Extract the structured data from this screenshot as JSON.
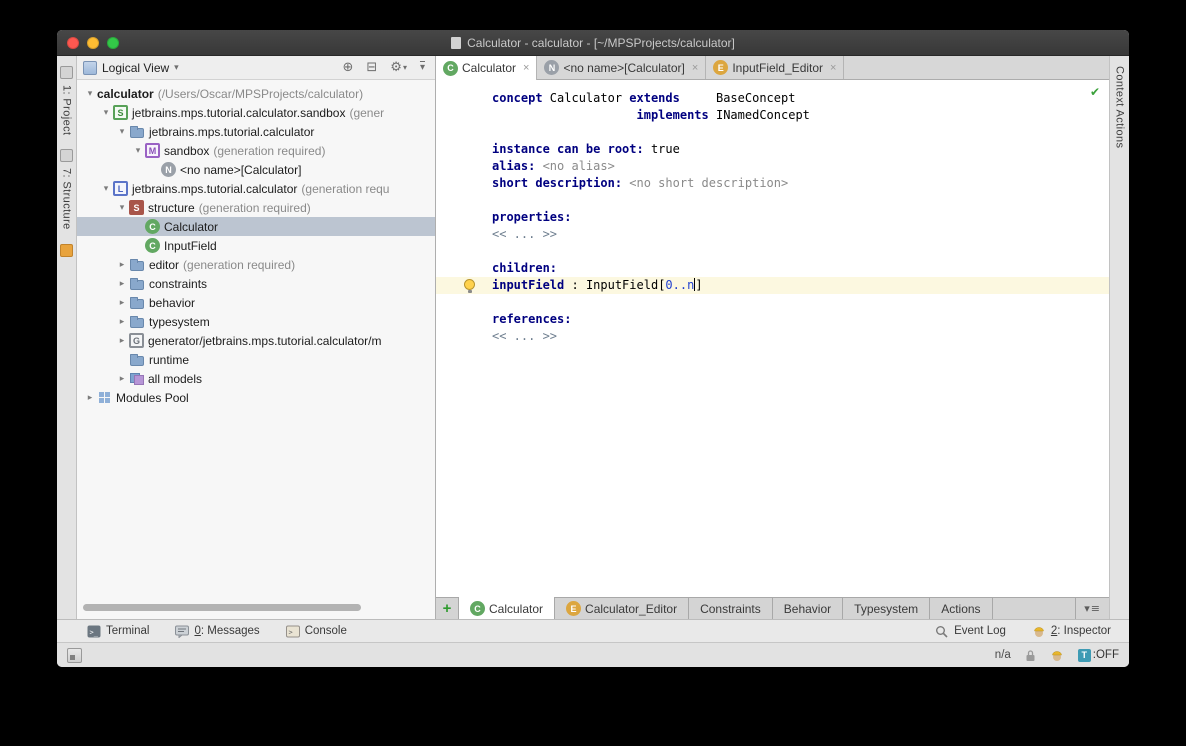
{
  "titlebar": {
    "title": "Calculator - calculator - [~/MPSProjects/calculator]"
  },
  "left_stripe": {
    "project_tab": "1: Project",
    "structure_tab": "7: Structure"
  },
  "right_stripe": {
    "context_actions_tab": "Context Actions"
  },
  "project_panel": {
    "view_selector": "Logical View",
    "header_icons": {
      "chevron": "▾",
      "locate": "⊕",
      "collapse": "⊟",
      "settings": "⚙",
      "settings_arrow": "▾",
      "hide": "▾"
    },
    "tree": [
      {
        "indent": 0,
        "arrow": "open",
        "icon": null,
        "label": "calculator",
        "suffix": "(/Users/Oscar/MPSProjects/calculator)",
        "bold": true
      },
      {
        "indent": 1,
        "arrow": "open",
        "icon": "solution",
        "label": "jetbrains.mps.tutorial.calculator.sandbox",
        "suffix": "(gener"
      },
      {
        "indent": 2,
        "arrow": "open",
        "icon": "folder",
        "label": "jetbrains.mps.tutorial.calculator"
      },
      {
        "indent": 3,
        "arrow": "open",
        "icon": "model",
        "label": "sandbox",
        "suffix": "(generation required)"
      },
      {
        "indent": 4,
        "arrow": null,
        "icon": "node",
        "label": "<no name>[Calculator]"
      },
      {
        "indent": 1,
        "arrow": "open",
        "icon": "language",
        "label": "jetbrains.mps.tutorial.calculator",
        "suffix": "(generation requ"
      },
      {
        "indent": 2,
        "arrow": "open",
        "icon": "structure",
        "label": "structure",
        "suffix": "(generation required)"
      },
      {
        "indent": 3,
        "arrow": null,
        "icon": "concept",
        "label": "Calculator",
        "selected": true
      },
      {
        "indent": 3,
        "arrow": null,
        "icon": "concept",
        "label": "InputField"
      },
      {
        "indent": 2,
        "arrow": "closed",
        "icon": "folder",
        "label": "editor",
        "suffix": "(generation required)"
      },
      {
        "indent": 2,
        "arrow": "closed",
        "icon": "folder",
        "label": "constraints"
      },
      {
        "indent": 2,
        "arrow": "closed",
        "icon": "folder",
        "label": "behavior"
      },
      {
        "indent": 2,
        "arrow": "closed",
        "icon": "folder",
        "label": "typesystem"
      },
      {
        "indent": 2,
        "arrow": "closed",
        "icon": "generator",
        "label": "generator/jetbrains.mps.tutorial.calculator/m"
      },
      {
        "indent": 2,
        "arrow": null,
        "icon": "folder",
        "label": "runtime"
      },
      {
        "indent": 2,
        "arrow": "closed",
        "icon": "models",
        "label": "all models"
      },
      {
        "indent": 0,
        "arrow": "closed",
        "icon": "modulesPool",
        "label": "Modules Pool"
      }
    ]
  },
  "icon_letters": {
    "concept": "C",
    "node": "N",
    "editor": "E",
    "solution": "S",
    "language": "L",
    "model": "M",
    "generator": "G",
    "structure": "S"
  },
  "editor_tabs": [
    {
      "icon": "concept",
      "label": "Calculator",
      "active": true
    },
    {
      "icon": "node",
      "label": "<no name>[Calculator]",
      "active": false
    },
    {
      "icon": "editor",
      "label": "InputField_Editor",
      "active": false
    }
  ],
  "editor": {
    "ok_check": "✔",
    "lines": [
      {
        "segments": [
          {
            "text": "concept ",
            "style": "kw"
          },
          {
            "text": "Calculator ",
            "style": "plain"
          },
          {
            "text": "extends",
            "style": "kw"
          },
          {
            "text": "     BaseConcept",
            "style": "plain"
          }
        ]
      },
      {
        "segments": [
          {
            "text": "                    ",
            "style": "plain"
          },
          {
            "text": "implements",
            "style": "kw"
          },
          {
            "text": " INamedConcept",
            "style": "plain"
          }
        ]
      },
      {
        "segments": []
      },
      {
        "segments": [
          {
            "text": "instance can be root:",
            "style": "kw"
          },
          {
            "text": " true",
            "style": "plain"
          }
        ]
      },
      {
        "segments": [
          {
            "text": "alias:",
            "style": "kw"
          },
          {
            "text": " <no alias>",
            "style": "muted"
          }
        ]
      },
      {
        "segments": [
          {
            "text": "short description:",
            "style": "kw"
          },
          {
            "text": " <no short description>",
            "style": "muted"
          }
        ]
      },
      {
        "segments": []
      },
      {
        "segments": [
          {
            "text": "properties:",
            "style": "kw"
          }
        ]
      },
      {
        "segments": [
          {
            "text": "<< ... >>",
            "style": "cellph"
          }
        ]
      },
      {
        "segments": []
      },
      {
        "segments": [
          {
            "text": "children:",
            "style": "kw"
          }
        ]
      },
      {
        "highlight": true,
        "bulb": true,
        "segments": [
          {
            "text": "inputField",
            "style": "kw"
          },
          {
            "text": " : ",
            "style": "plain"
          },
          {
            "text": "InputField",
            "style": "plain"
          },
          {
            "text": "[",
            "style": "plain"
          },
          {
            "text": "0..n",
            "style": "blue"
          },
          {
            "text": "",
            "style": "caret"
          },
          {
            "text": "]",
            "style": "plain"
          }
        ]
      },
      {
        "segments": []
      },
      {
        "segments": [
          {
            "text": "references:",
            "style": "kw"
          }
        ]
      },
      {
        "segments": [
          {
            "text": "<< ... >>",
            "style": "cellph"
          }
        ]
      }
    ]
  },
  "aspect_tabs": {
    "add_label": "+",
    "options_glyph": "▾≡",
    "tabs": [
      {
        "icon": "concept",
        "label": "Calculator",
        "active": true
      },
      {
        "icon": "editor",
        "label": "Calculator_Editor",
        "active": false
      },
      {
        "icon": null,
        "label": "Constraints",
        "active": false
      },
      {
        "icon": null,
        "label": "Behavior",
        "active": false
      },
      {
        "icon": null,
        "label": "Typesystem",
        "active": false
      },
      {
        "icon": null,
        "label": "Actions",
        "active": false
      }
    ]
  },
  "toolbar": {
    "left": [
      {
        "icon": "terminal",
        "label": "Terminal"
      },
      {
        "icon": "messages",
        "mnemonic": "0",
        "label": ": Messages"
      },
      {
        "icon": "console",
        "label": "Console"
      }
    ],
    "right": [
      {
        "icon": "search",
        "label": "Event Log"
      },
      {
        "icon": "inspector",
        "mnemonic": "2",
        "label": ": Inspector"
      }
    ]
  },
  "statusbar": {
    "position": "n/a",
    "t_badge": "T",
    "t_state": ":OFF"
  },
  "colors": {
    "keyword_blue": "#000080",
    "caret_line_yellow": "#fcf8e0",
    "tree_selection": "#bcc5d1",
    "ok_green": "#3ba13b",
    "add_tab_green": "#2f9b2f",
    "titlebar_dark": "#3f3f3f"
  }
}
